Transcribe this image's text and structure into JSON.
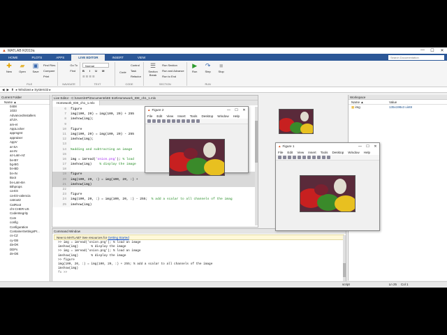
{
  "app": {
    "title": "MATLAB R2019a",
    "window_controls": [
      "—",
      "☐",
      "✕"
    ]
  },
  "tabs": [
    {
      "label": "HOME",
      "active": false
    },
    {
      "label": "PLOTS",
      "active": false
    },
    {
      "label": "APPS",
      "active": false
    },
    {
      "label": "LIVE EDITOR",
      "active": true
    },
    {
      "label": "INSERT",
      "active": false
    },
    {
      "label": "VIEW",
      "active": false
    }
  ],
  "search_placeholder": "Search Documentation",
  "ribbon": {
    "file": {
      "label": "FILE",
      "new": "New",
      "open": "Open",
      "save": "Save",
      "find_files": "Find Files",
      "compare": "Compare",
      "print": "Print"
    },
    "navigate": {
      "label": "NAVIGATE",
      "go_to": "Go To",
      "find": "Find"
    },
    "text": {
      "label": "TEXT",
      "style": "Normal"
    },
    "code": {
      "label": "CODE",
      "code": "Code",
      "control": "Control",
      "task": "Task",
      "refactor": "Refactor"
    },
    "section": {
      "label": "SECTION",
      "section_break": "Section Break",
      "run_section": "Run Section",
      "run_and_advance": "Run and Advance",
      "run_to_end": "Run to End"
    },
    "run": {
      "label": "RUN",
      "run": "Run",
      "step": "Step",
      "stop": "Stop"
    }
  },
  "address": {
    "path": "▸ Windows ▸ System32 ▸"
  },
  "current_folder": {
    "title": "Current Folder",
    "column": "Name ▲",
    "items": [
      "0408",
      "1033",
      "AdvancedInstallers",
      "af-ZA",
      "am-et",
      "AppLocker",
      "appmgmt",
      "appraiser",
      "AppV",
      "ar-SA",
      "as-IN",
      "az-Latn-AZ",
      "be-BY",
      "bg-BG",
      "bn-BD",
      "bn-IN",
      "Boot",
      "bs-Latn-BA",
      "Bthprops",
      "ca-ES",
      "ca-ES-valencia",
      "catroot2",
      "CatRoot",
      "chr-CHER-US",
      "CodeIntegrity",
      "Com",
      "config",
      "Configuration",
      "ContainerSettingsPr...",
      "cs-CZ",
      "cy-GB",
      "da-DK",
      "DDFs",
      "de-DE"
    ],
    "details": "Details"
  },
  "live_editor": {
    "title": "Live Editor - C:\\Users\\HP\\Documents\\EE 518\\Homework_IDE_ch1_1.mlx",
    "tab": "Homework_IDE_ch1_1.mlx",
    "lines": [
      {
        "n": "6",
        "parts": [
          [
            "figure",
            ""
          ]
        ],
        "hl": false
      },
      {
        "n": "7",
        "parts": [
          [
            "img(100, 20) = img(100, 20) + 255",
            ""
          ]
        ],
        "hl": false
      },
      {
        "n": "8",
        "parts": [
          [
            "imshow(img);",
            ""
          ]
        ],
        "hl": false
      },
      {
        "n": "9",
        "parts": [
          [
            "",
            ""
          ]
        ],
        "hl": false
      },
      {
        "n": "10",
        "parts": [
          [
            "figure",
            ""
          ]
        ],
        "hl": false
      },
      {
        "n": "11",
        "parts": [
          [
            "img(100, 20) = img(100, 20) - 255",
            ""
          ]
        ],
        "hl": false
      },
      {
        "n": "12",
        "parts": [
          [
            "imshow(img);",
            ""
          ]
        ],
        "hl": false
      },
      {
        "n": "13",
        "parts": [
          [
            "",
            ""
          ]
        ],
        "hl": false
      },
      {
        "n": "14",
        "parts": [
          [
            "%adding and subtracting an image",
            "cmt"
          ]
        ],
        "hl": false
      },
      {
        "n": "15",
        "parts": [
          [
            "",
            ""
          ]
        ],
        "hl": false
      },
      {
        "n": "16",
        "parts": [
          [
            "img = imread(",
            ""
          ],
          [
            "'onion.png'",
            "str"
          ],
          [
            "); ",
            ""
          ],
          [
            "% load",
            "cmt"
          ]
        ],
        "hl": false
      },
      {
        "n": "17",
        "parts": [
          [
            "imshow(img)    ",
            ""
          ],
          [
            "% display the image",
            "cmt"
          ]
        ],
        "hl": false
      },
      {
        "n": "18",
        "parts": [
          [
            "",
            ""
          ]
        ],
        "hl": false
      },
      {
        "n": "19",
        "parts": [
          [
            "figure",
            ""
          ]
        ],
        "hl": true
      },
      {
        "n": "20",
        "parts": [
          [
            "img(100, 20, :) = img(100, 20, :) +",
            ""
          ]
        ],
        "hl": true
      },
      {
        "n": "21",
        "parts": [
          [
            "imshow(img)",
            ""
          ]
        ],
        "hl": true
      },
      {
        "n": "22",
        "parts": [
          [
            "",
            ""
          ]
        ],
        "hl": false
      },
      {
        "n": "23",
        "parts": [
          [
            "figure",
            ""
          ]
        ],
        "hl": false
      },
      {
        "n": "24",
        "parts": [
          [
            "img(100, 20, :) = img(100, 20, :) - 255;  ",
            ""
          ],
          [
            "% add a scalar to all channels of the imag",
            "cmt"
          ]
        ],
        "hl": false
      },
      {
        "n": "25",
        "parts": [
          [
            "imshow(img)",
            ""
          ]
        ],
        "hl": false
      }
    ]
  },
  "command_window": {
    "title": "Command Window",
    "new_text": "New to MATLAB? See resources for ",
    "getting_started": "Getting Started",
    "lines": [
      ">> img = imread('onion.png'); % load an image",
      "imshow(img)       % display the image",
      ">> img = imread('onion.png'); % load an image",
      "imshow(img)       % display the image",
      ">> figure",
      "img(100, 20, :) = img(100, 20, :) + 255; % add a scalar to all channels of the image",
      "imshow(img)"
    ],
    "prompt": "fx >>"
  },
  "workspace": {
    "title": "Workspace",
    "col_name": "Name ▲",
    "col_value": "Value",
    "vars": [
      {
        "name": "img",
        "value": "135x198x3 uint8"
      }
    ]
  },
  "status": {
    "mode": "script",
    "ln": "Ln  25",
    "col": "Col  1"
  },
  "figure2": {
    "title": "Figure 2",
    "menu": [
      "File",
      "Edit",
      "View",
      "Insert",
      "Tools",
      "Desktop",
      "Window",
      "Help"
    ]
  },
  "figure1": {
    "title": "Figure 1",
    "menu": [
      "File",
      "Edit",
      "View",
      "Insert",
      "Tools",
      "Desktop",
      "Window",
      "Help"
    ]
  }
}
